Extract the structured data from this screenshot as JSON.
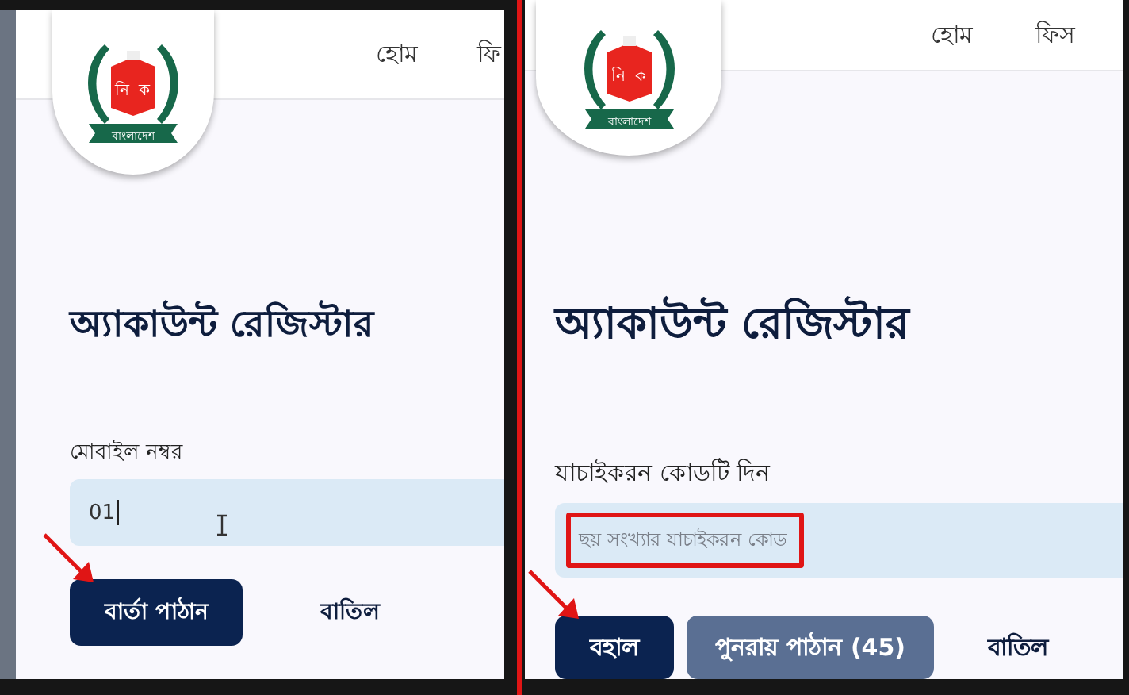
{
  "panels": [
    {
      "nav": [
        "হোম",
        "ফি"
      ],
      "logo": {
        "box_letters": [
          "নি",
          "ক"
        ],
        "ribbon": "বাংলাদেশ"
      },
      "title": "অ্যাকাউন্ট রেজিস্টার",
      "field": {
        "label": "মোবাইল নম্বর",
        "value": "01",
        "focused": true,
        "highlighted": false
      },
      "buttons": [
        {
          "label": "বার্তা পাঠান",
          "kind": "primary",
          "arrow": true
        },
        {
          "label": "বাতিল",
          "kind": "text"
        }
      ]
    },
    {
      "nav": [
        "হোম",
        "ফিস"
      ],
      "logo": {
        "box_letters": [
          "নি",
          "ক"
        ],
        "ribbon": "বাংলাদেশ"
      },
      "title": "অ্যাকাউন্ট রেজিস্টার",
      "field": {
        "label": "যাচাইকরন কোডটি দিন",
        "placeholder": "ছয় সংখ্যার যাচাইকরন কোড",
        "focused": false,
        "highlighted": true
      },
      "buttons": [
        {
          "label": "বহাল",
          "kind": "primary",
          "arrow": true
        },
        {
          "label": "পুনরায় পাঠান (45)",
          "kind": "secondary"
        },
        {
          "label": "বাতিল",
          "kind": "text"
        }
      ]
    }
  ]
}
